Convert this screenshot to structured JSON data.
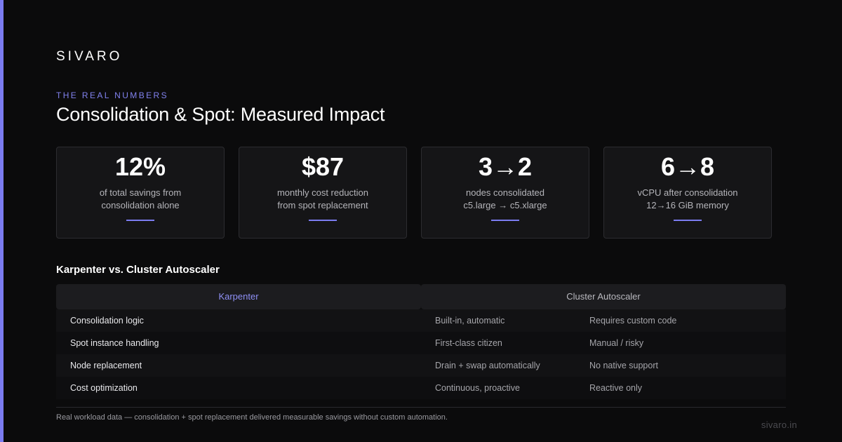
{
  "brand": "SIVARO",
  "eyebrow": "THE REAL NUMBERS",
  "title": "Consolidation & Spot: Measured Impact",
  "stats": [
    {
      "value": "12%",
      "line1": "of total savings from",
      "line2": "consolidation alone"
    },
    {
      "value": "$87",
      "line1": "monthly cost reduction",
      "line2": "from spot replacement"
    },
    {
      "value": "3→2",
      "line1": "nodes consolidated",
      "line2": "c5.large → c5.xlarge"
    },
    {
      "value": "6→8",
      "line1": "vCPU after consolidation",
      "line2": "12→16 GiB memory"
    }
  ],
  "comparison": {
    "heading": "Karpenter vs. Cluster Autoscaler",
    "col_karpenter": "Karpenter",
    "col_ca": "Cluster Autoscaler",
    "rows": [
      {
        "feature": "Consolidation logic",
        "karpenter": "Built-in, automatic",
        "ca": "Requires custom code"
      },
      {
        "feature": "Spot instance handling",
        "karpenter": "First-class citizen",
        "ca": "Manual / risky"
      },
      {
        "feature": "Node replacement",
        "karpenter": "Drain + swap automatically",
        "ca": "No native support"
      },
      {
        "feature": "Cost optimization",
        "karpenter": "Continuous, proactive",
        "ca": "Reactive only"
      }
    ]
  },
  "footnote": "Real workload data — consolidation + spot replacement delivered measurable savings without custom automation.",
  "site": "sivaro.in",
  "colors": {
    "accent": "#7b7cf0",
    "background": "#0b0b0c",
    "card": "#151517"
  }
}
